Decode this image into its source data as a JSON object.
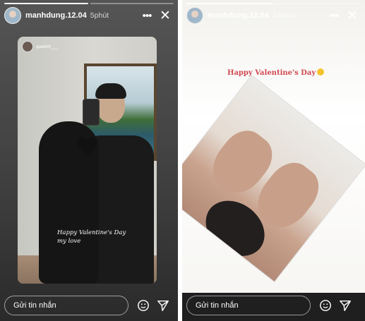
{
  "stories": [
    {
      "username": "manhdung.12.04",
      "time": "5phút",
      "mention": "quelinh___",
      "caption_line1": "Happy Valentine's Day",
      "caption_line2": "my love",
      "message_placeholder": "Gửi tin nhắn",
      "icons": {
        "more": "more-icon",
        "close": "close-icon",
        "sticker": "sticker-icon",
        "send": "send-icon"
      }
    },
    {
      "username": "manhdung.12.04",
      "time": "14phút",
      "headline": "Happy Valentine's Day",
      "message_placeholder": "Gửi tin nhắn",
      "icons": {
        "more": "more-icon",
        "close": "close-icon",
        "sticker": "sticker-icon",
        "send": "send-icon"
      }
    }
  ],
  "colors": {
    "headline": "#d04850",
    "heart": "#111111",
    "emoji": "#f5c32d"
  }
}
